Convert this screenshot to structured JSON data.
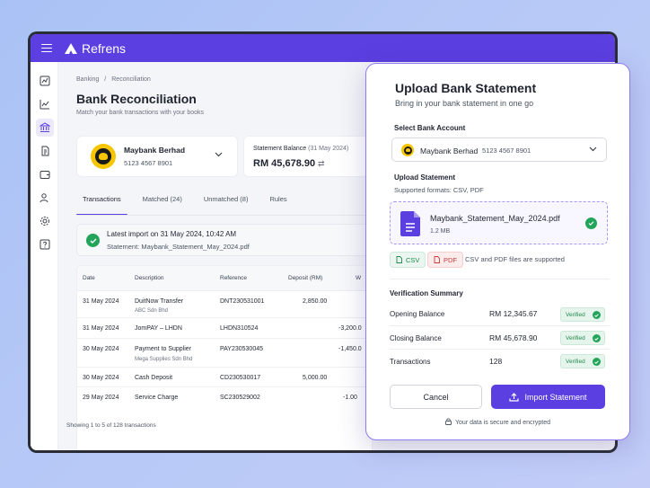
{
  "app": {
    "name": "Refrens",
    "brand_color": "#5b3fe0"
  },
  "breadcrumb": {
    "root": "Banking",
    "current": "Reconciliation"
  },
  "page": {
    "title": "Bank Reconciliation",
    "subtitle": "Match your bank transactions with your books"
  },
  "sidebar": {
    "icons": [
      "dashboard-icon",
      "chart-icon",
      "bank-icon",
      "document-icon",
      "wallet-icon",
      "users-icon",
      "settings-icon",
      "help-icon"
    ],
    "active": "bank-icon"
  },
  "bank_card": {
    "name": "Maybank Berhad",
    "account": "5123 4567 8901"
  },
  "statement": {
    "label": "Statement Balance",
    "date": "(31 May 2024)",
    "amount": "RM 45,678.90"
  },
  "tabs": [
    {
      "label": "Transactions",
      "active": true
    },
    {
      "label": "Matched (24)",
      "active": false
    },
    {
      "label": "Unmatched (8)",
      "active": false
    },
    {
      "label": "Rules",
      "active": false
    }
  ],
  "latest_import": {
    "title": "Latest import on 31 May 2024, 10:42 AM",
    "subtitle": "Statement: Maybank_Statement_May_2024.pdf"
  },
  "table": {
    "columns": [
      "Date",
      "Description",
      "Reference",
      "Deposit (RM)",
      "W"
    ],
    "rows": [
      {
        "date": "31 May 2024",
        "desc": "DuitNow Transfer",
        "desc_sub": "ABC Sdn Bhd",
        "ref": "DNT230531001",
        "deposit": "2,850.00",
        "withdrawal": ""
      },
      {
        "date": "31 May 2024",
        "desc": "JomPAY – LHDN",
        "desc_sub": "",
        "ref": "LHDN310524",
        "deposit": "",
        "withdrawal": "-3,200.0"
      },
      {
        "date": "30 May 2024",
        "desc": "Payment to Supplier",
        "desc_sub": "Mega Supplies Sdn Bhd",
        "ref": "PAY230530045",
        "deposit": "",
        "withdrawal": "-1,450.0"
      },
      {
        "date": "30 May 2024",
        "desc": "Cash Deposit",
        "desc_sub": "",
        "ref": "CD230530017",
        "deposit": "5,000.00",
        "withdrawal": ""
      },
      {
        "date": "29 May 2024",
        "desc": "Service Charge",
        "desc_sub": "",
        "ref": "SC230529002",
        "deposit": "",
        "withdrawal": "-1.00"
      }
    ],
    "footer": "Showing 1 to 5 of 128 transactions"
  },
  "modal": {
    "title": "Upload Bank Statement",
    "subtitle": "Bring in your bank statement in one go",
    "select_label": "Select Bank Account",
    "selected_bank": "Maybank Berhad",
    "selected_account": "5123 4567 8901",
    "upload_label": "Upload Statement",
    "upload_formats": "Supported formats: CSV, PDF",
    "file": {
      "name": "Maybank_Statement_May_2024.pdf",
      "size": "1.2 MB"
    },
    "chips": {
      "csv": "CSV",
      "pdf": "PDF"
    },
    "formats_note": "CSV and PDF files are supported",
    "verification_title": "Verification Summary",
    "verification": [
      {
        "label": "Opening Balance",
        "value": "RM 12,345.67",
        "status": "Verified"
      },
      {
        "label": "Closing Balance",
        "value": "RM 45,678.90",
        "status": "Verified"
      },
      {
        "label": "Transactions",
        "value": "128",
        "status": "Verified"
      }
    ],
    "cancel_label": "Cancel",
    "import_label": "Import Statement",
    "secure_note": "Your data is secure and encrypted"
  }
}
